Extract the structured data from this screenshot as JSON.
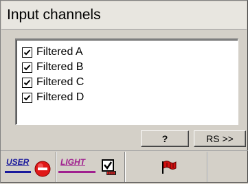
{
  "window": {
    "title": "Input channels"
  },
  "channels": {
    "items": [
      {
        "label": "Filtered A",
        "checked": true
      },
      {
        "label": "Filtered B",
        "checked": true
      },
      {
        "label": "Filtered C",
        "checked": true
      },
      {
        "label": "Filtered D",
        "checked": true
      }
    ]
  },
  "buttons": {
    "help_label": "?",
    "rs_label": "RS >>"
  },
  "toolbar": {
    "user_label": "USER",
    "light_label": "LIGHT",
    "icons": [
      "stop-icon",
      "checkbox-tool-icon",
      "flag-icon"
    ],
    "colors": {
      "user": "#1a1a9c",
      "light": "#a0208f",
      "stop": "#e01818",
      "flag": "#d01010"
    }
  }
}
